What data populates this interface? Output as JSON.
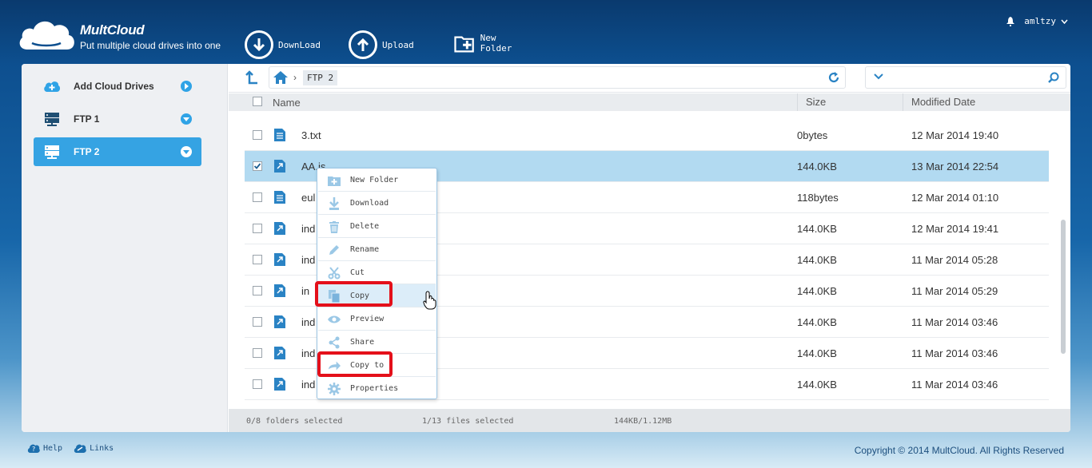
{
  "app": {
    "name": "MultCloud",
    "tagline": "Put multiple cloud drives into one",
    "user": "amltzy"
  },
  "toolbar": {
    "download": "DownLoad",
    "upload": "Upload",
    "new_folder": "New Folder"
  },
  "sidebar": {
    "items": [
      {
        "label": "Add Cloud Drives",
        "icon": "cloud-plus-icon"
      },
      {
        "label": "FTP 1",
        "icon": "ftp-icon"
      },
      {
        "label": "FTP 2",
        "icon": "ftp-icon",
        "active": true
      }
    ]
  },
  "path": {
    "current": "FTP 2"
  },
  "search": {
    "value": ""
  },
  "table": {
    "headers": {
      "name": "Name",
      "size": "Size",
      "date": "Modified Date"
    },
    "rows": [
      {
        "name": "3.txt",
        "size": "0bytes",
        "date": "12 Mar 2014 19:40",
        "type": "text"
      },
      {
        "name": "AA.js",
        "size": "144.0KB",
        "date": "13 Mar 2014 22:54",
        "type": "script",
        "selected": true
      },
      {
        "name": "eul",
        "size": "118bytes",
        "date": "12 Mar 2014 01:10",
        "type": "text"
      },
      {
        "name": "ind",
        "size": "144.0KB",
        "date": "12 Mar 2014 19:41",
        "type": "script"
      },
      {
        "name": "ind",
        "size": "144.0KB",
        "date": "11 Mar 2014 05:28",
        "type": "script"
      },
      {
        "name": "in",
        "size": "144.0KB",
        "date": "11 Mar 2014 05:29",
        "type": "script"
      },
      {
        "name": "ind",
        "size": "144.0KB",
        "date": "11 Mar 2014 03:46",
        "type": "script"
      },
      {
        "name": "ind",
        "size": "144.0KB",
        "date": "11 Mar 2014 03:46",
        "type": "script"
      },
      {
        "name": "ind",
        "size": "144.0KB",
        "date": "11 Mar 2014 03:46",
        "type": "script"
      }
    ]
  },
  "status": {
    "folders": "0/8 folders selected",
    "files": "1/13 files selected",
    "size": "144KB/1.12MB"
  },
  "context_menu": {
    "items": [
      {
        "label": "New Folder",
        "icon": "new-folder-icon"
      },
      {
        "label": "Download",
        "icon": "download-icon"
      },
      {
        "label": "Delete",
        "icon": "trash-icon"
      },
      {
        "label": "Rename",
        "icon": "pencil-icon"
      },
      {
        "label": "Cut",
        "icon": "scissors-icon"
      },
      {
        "label": "Copy",
        "icon": "copy-icon",
        "highlighted": true
      },
      {
        "label": "Preview",
        "icon": "eye-icon"
      },
      {
        "label": "Share",
        "icon": "share-icon"
      },
      {
        "label": "Copy to",
        "icon": "copy-to-icon",
        "highlighted": true
      },
      {
        "label": "Properties",
        "icon": "gear-icon"
      }
    ]
  },
  "footer": {
    "help": "Help",
    "links": "Links",
    "copyright": "Copyright © 2014 MultCloud. All Rights Reserved"
  },
  "colors": {
    "accent": "#35a3e3",
    "selected_row": "#b2daf1",
    "highlight_box": "#e4101a"
  }
}
